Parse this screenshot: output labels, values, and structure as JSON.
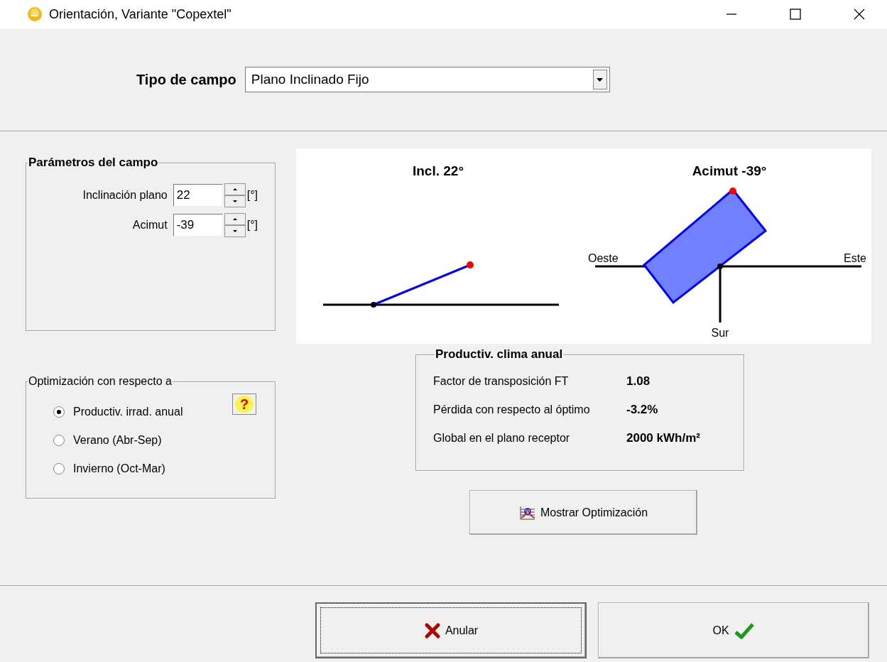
{
  "window": {
    "title": "Orientación, Variante \"Copextel\""
  },
  "field_type": {
    "label": "Tipo de campo",
    "value": "Plano Inclinado Fijo"
  },
  "field_parameters": {
    "title": "Parámetros del campo",
    "inputs": [
      {
        "label": "Inclinación plano",
        "value": "22",
        "unit": "[°]"
      },
      {
        "label": "Acimut",
        "value": "-39",
        "unit": "[°]"
      }
    ]
  },
  "diagram": {
    "tilt_title": "Incl. 22°",
    "azimuth_title": "Acimut -39°",
    "west": "Oeste",
    "east": "Este",
    "south": "Sur"
  },
  "optimization": {
    "title": "Optimización con respecto a",
    "help": "?",
    "options": [
      {
        "label": "Productiv. irrad. anual",
        "selected": true
      },
      {
        "label": "Verano (Abr-Sep)",
        "selected": false
      },
      {
        "label": "Invierno (Oct-Mar)",
        "selected": false
      }
    ]
  },
  "productivity": {
    "title": "Productiv. clima anual",
    "rows": [
      {
        "label": "Factor de transposición FT",
        "value": "1.08"
      },
      {
        "label": "Pérdida con respecto al óptimo",
        "value": "-3.2%"
      },
      {
        "label": "Global en el plano receptor",
        "value": "2000 kWh/m²"
      }
    ]
  },
  "show_optimization_button": "Mostrar Optimización",
  "buttons": [
    {
      "kind": "cancel",
      "label": "Anular"
    },
    {
      "kind": "ok",
      "label": "OK"
    }
  ]
}
